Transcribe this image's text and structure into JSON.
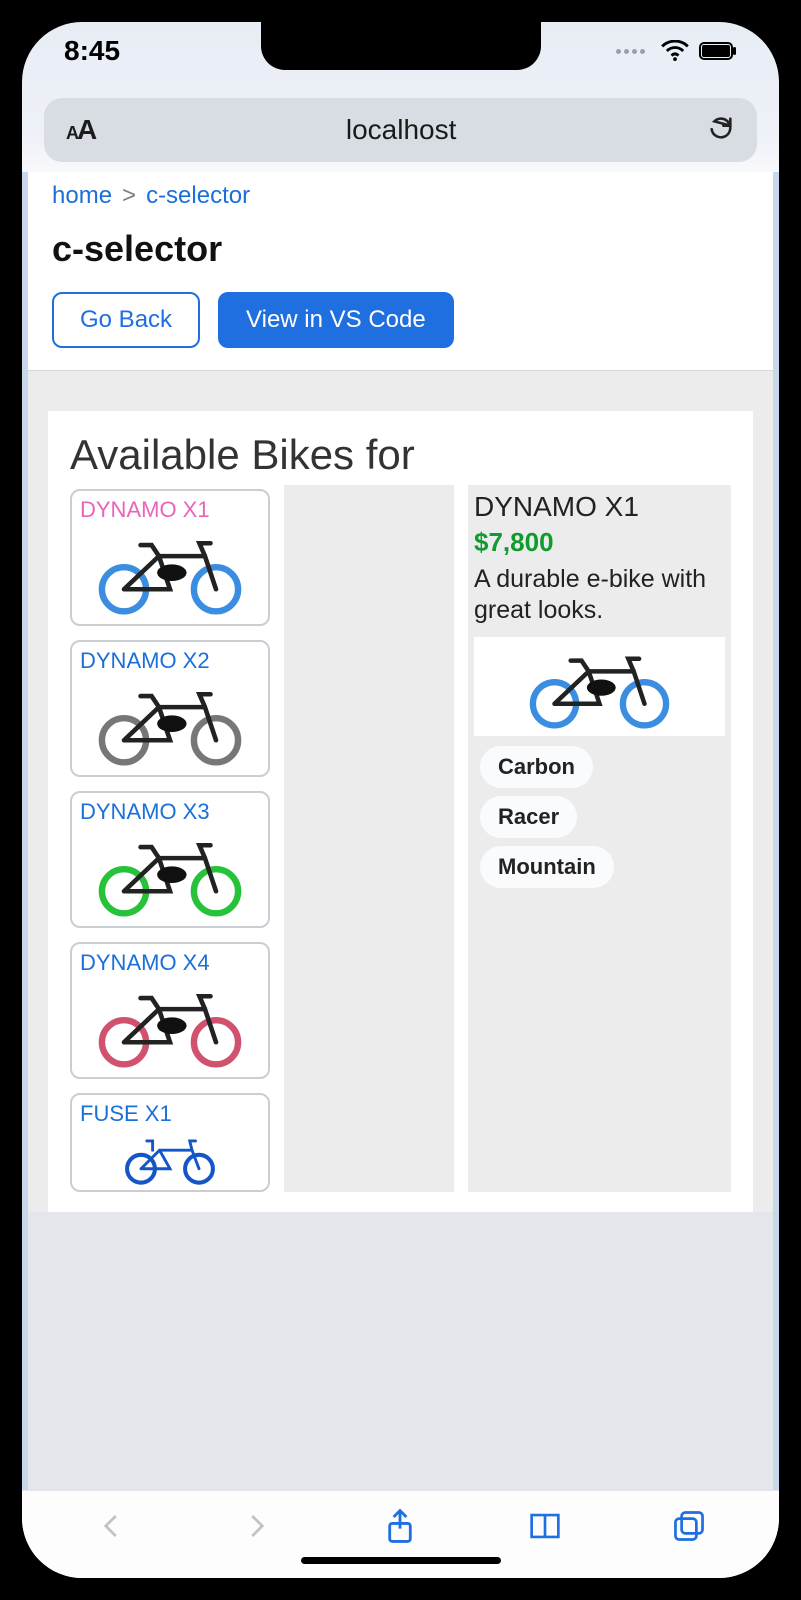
{
  "status": {
    "time": "8:45"
  },
  "browser": {
    "host": "localhost"
  },
  "breadcrumb": {
    "home": "home",
    "sep": ">",
    "current": "c-selector"
  },
  "page": {
    "title": "c-selector"
  },
  "buttons": {
    "back": "Go Back",
    "vscode": "View in VS Code"
  },
  "section_title": "Available Bikes for",
  "tiles": [
    {
      "name": "DYNAMO X1"
    },
    {
      "name": "DYNAMO X2"
    },
    {
      "name": "DYNAMO X3"
    },
    {
      "name": "DYNAMO X4"
    },
    {
      "name": "FUSE X1"
    }
  ],
  "detail": {
    "name": "DYNAMO X1",
    "price": "$7,800",
    "desc": "A durable e-bike with great looks.",
    "tags": [
      "Carbon",
      "Racer",
      "Mountain"
    ]
  }
}
